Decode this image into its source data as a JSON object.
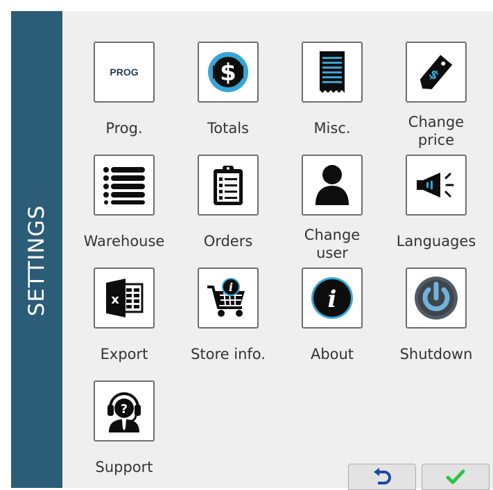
{
  "sidebar": {
    "title": "SETTINGS"
  },
  "tiles": [
    {
      "label": "Prog.",
      "icon": "prog-icon",
      "icon_text": "PROG"
    },
    {
      "label": "Totals",
      "icon": "dollar-icon"
    },
    {
      "label": "Misc.",
      "icon": "receipt-icon"
    },
    {
      "label": "Change\nprice",
      "icon": "price-tag-icon"
    },
    {
      "label": "Warehouse",
      "icon": "list-icon"
    },
    {
      "label": "Orders",
      "icon": "clipboard-icon"
    },
    {
      "label": "Change\nuser",
      "icon": "user-icon"
    },
    {
      "label": "Languages",
      "icon": "megaphone-icon"
    },
    {
      "label": "Export",
      "icon": "excel-icon"
    },
    {
      "label": "Store info.",
      "icon": "cart-info-icon"
    },
    {
      "label": "About",
      "icon": "info-icon"
    },
    {
      "label": "Shutdown",
      "icon": "power-icon"
    },
    {
      "label": "Support",
      "icon": "support-icon"
    }
  ],
  "footer": {
    "back_icon": "undo-icon",
    "confirm_icon": "checkmark-icon"
  },
  "colors": {
    "sidebar": "#2b5c78",
    "icon_dark": "#0d0d0d",
    "icon_blue": "#35a6d6",
    "power_blue": "#6fb2da",
    "check_green": "#2fc14a"
  }
}
